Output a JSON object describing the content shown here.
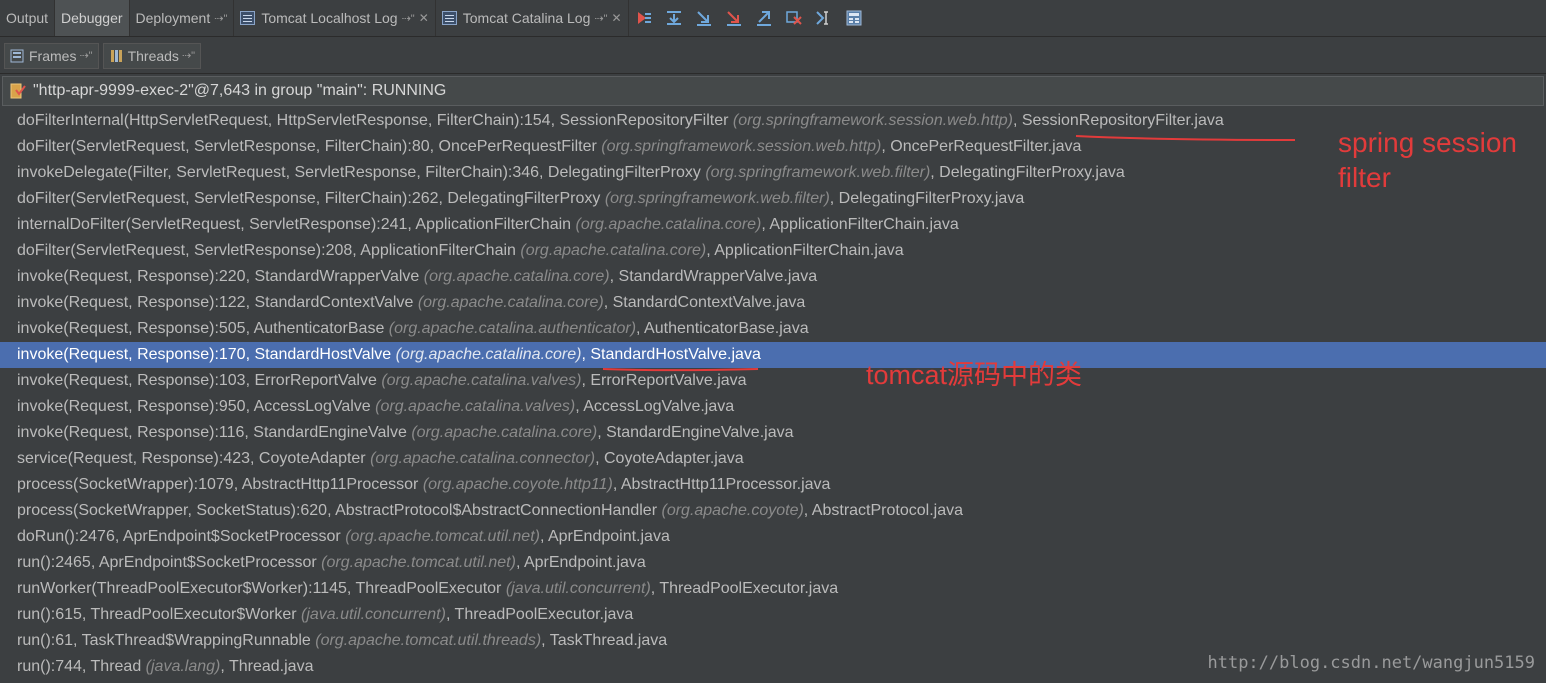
{
  "tabs": [
    {
      "label": "Output"
    },
    {
      "label": "Debugger"
    },
    {
      "label": "Deployment",
      "pin": "⇢\""
    },
    {
      "label": "Tomcat Localhost Log",
      "pin": "⇢\"",
      "close": "✕"
    },
    {
      "label": "Tomcat Catalina Log",
      "pin": "⇢\"",
      "close": "✕"
    }
  ],
  "toolbar_icons": [
    "show-execution-point-icon",
    "step-over-icon",
    "step-into-icon",
    "force-step-into-icon",
    "step-out-icon",
    "drop-frame-icon",
    "run-to-cursor-icon",
    "evaluate-expression-icon"
  ],
  "subtabs": [
    {
      "label": "Frames",
      "pin": "⇢\""
    },
    {
      "label": "Threads",
      "pin": "⇢\""
    }
  ],
  "thread": {
    "label": "\"http-apr-9999-exec-2\"@7,643 in group \"main\": RUNNING"
  },
  "frames": [
    {
      "method": "doFilterInternal(HttpServletRequest, HttpServletResponse, FilterChain):154, SessionRepositoryFilter ",
      "pkg": "(org.springframework.session.web.http)",
      "file": ", SessionRepositoryFilter.java"
    },
    {
      "method": "doFilter(ServletRequest, ServletResponse, FilterChain):80, OncePerRequestFilter ",
      "pkg": "(org.springframework.session.web.http)",
      "file": ", OncePerRequestFilter.java"
    },
    {
      "method": "invokeDelegate(Filter, ServletRequest, ServletResponse, FilterChain):346, DelegatingFilterProxy ",
      "pkg": "(org.springframework.web.filter)",
      "file": ", DelegatingFilterProxy.java"
    },
    {
      "method": "doFilter(ServletRequest, ServletResponse, FilterChain):262, DelegatingFilterProxy ",
      "pkg": "(org.springframework.web.filter)",
      "file": ", DelegatingFilterProxy.java"
    },
    {
      "method": "internalDoFilter(ServletRequest, ServletResponse):241, ApplicationFilterChain ",
      "pkg": "(org.apache.catalina.core)",
      "file": ", ApplicationFilterChain.java"
    },
    {
      "method": "doFilter(ServletRequest, ServletResponse):208, ApplicationFilterChain ",
      "pkg": "(org.apache.catalina.core)",
      "file": ", ApplicationFilterChain.java"
    },
    {
      "method": "invoke(Request, Response):220, StandardWrapperValve ",
      "pkg": "(org.apache.catalina.core)",
      "file": ", StandardWrapperValve.java"
    },
    {
      "method": "invoke(Request, Response):122, StandardContextValve ",
      "pkg": "(org.apache.catalina.core)",
      "file": ", StandardContextValve.java"
    },
    {
      "method": "invoke(Request, Response):505, AuthenticatorBase ",
      "pkg": "(org.apache.catalina.authenticator)",
      "file": ", AuthenticatorBase.java"
    },
    {
      "method": "invoke(Request, Response):170, StandardHostValve ",
      "pkg": "(org.apache.catalina.core)",
      "file": ", StandardHostValve.java"
    },
    {
      "method": "invoke(Request, Response):103, ErrorReportValve ",
      "pkg": "(org.apache.catalina.valves)",
      "file": ", ErrorReportValve.java"
    },
    {
      "method": "invoke(Request, Response):950, AccessLogValve ",
      "pkg": "(org.apache.catalina.valves)",
      "file": ", AccessLogValve.java"
    },
    {
      "method": "invoke(Request, Response):116, StandardEngineValve ",
      "pkg": "(org.apache.catalina.core)",
      "file": ", StandardEngineValve.java"
    },
    {
      "method": "service(Request, Response):423, CoyoteAdapter ",
      "pkg": "(org.apache.catalina.connector)",
      "file": ", CoyoteAdapter.java"
    },
    {
      "method": "process(SocketWrapper):1079, AbstractHttp11Processor ",
      "pkg": "(org.apache.coyote.http11)",
      "file": ", AbstractHttp11Processor.java"
    },
    {
      "method": "process(SocketWrapper, SocketStatus):620, AbstractProtocol$AbstractConnectionHandler ",
      "pkg": "(org.apache.coyote)",
      "file": ", AbstractProtocol.java"
    },
    {
      "method": "doRun():2476, AprEndpoint$SocketProcessor ",
      "pkg": "(org.apache.tomcat.util.net)",
      "file": ", AprEndpoint.java"
    },
    {
      "method": "run():2465, AprEndpoint$SocketProcessor ",
      "pkg": "(org.apache.tomcat.util.net)",
      "file": ", AprEndpoint.java"
    },
    {
      "method": "runWorker(ThreadPoolExecutor$Worker):1145, ThreadPoolExecutor ",
      "pkg": "(java.util.concurrent)",
      "file": ", ThreadPoolExecutor.java"
    },
    {
      "method": "run():615, ThreadPoolExecutor$Worker ",
      "pkg": "(java.util.concurrent)",
      "file": ", ThreadPoolExecutor.java"
    },
    {
      "method": "run():61, TaskThread$WrappingRunnable ",
      "pkg": "(org.apache.tomcat.util.threads)",
      "file": ", TaskThread.java"
    },
    {
      "method": "run():744, Thread ",
      "pkg": "(java.lang)",
      "file": ", Thread.java"
    }
  ],
  "selected_frame": 9,
  "annotations": {
    "spring_line1": "spring session",
    "spring_line2": "filter",
    "tomcat": "tomcat源码中的类"
  },
  "watermark": "http://blog.csdn.net/wangjun5159",
  "colors": {
    "background": "#3c3f41",
    "selection": "#4b6eaf",
    "annotation": "#e23b3b",
    "package_text": "#8b8b8b"
  }
}
